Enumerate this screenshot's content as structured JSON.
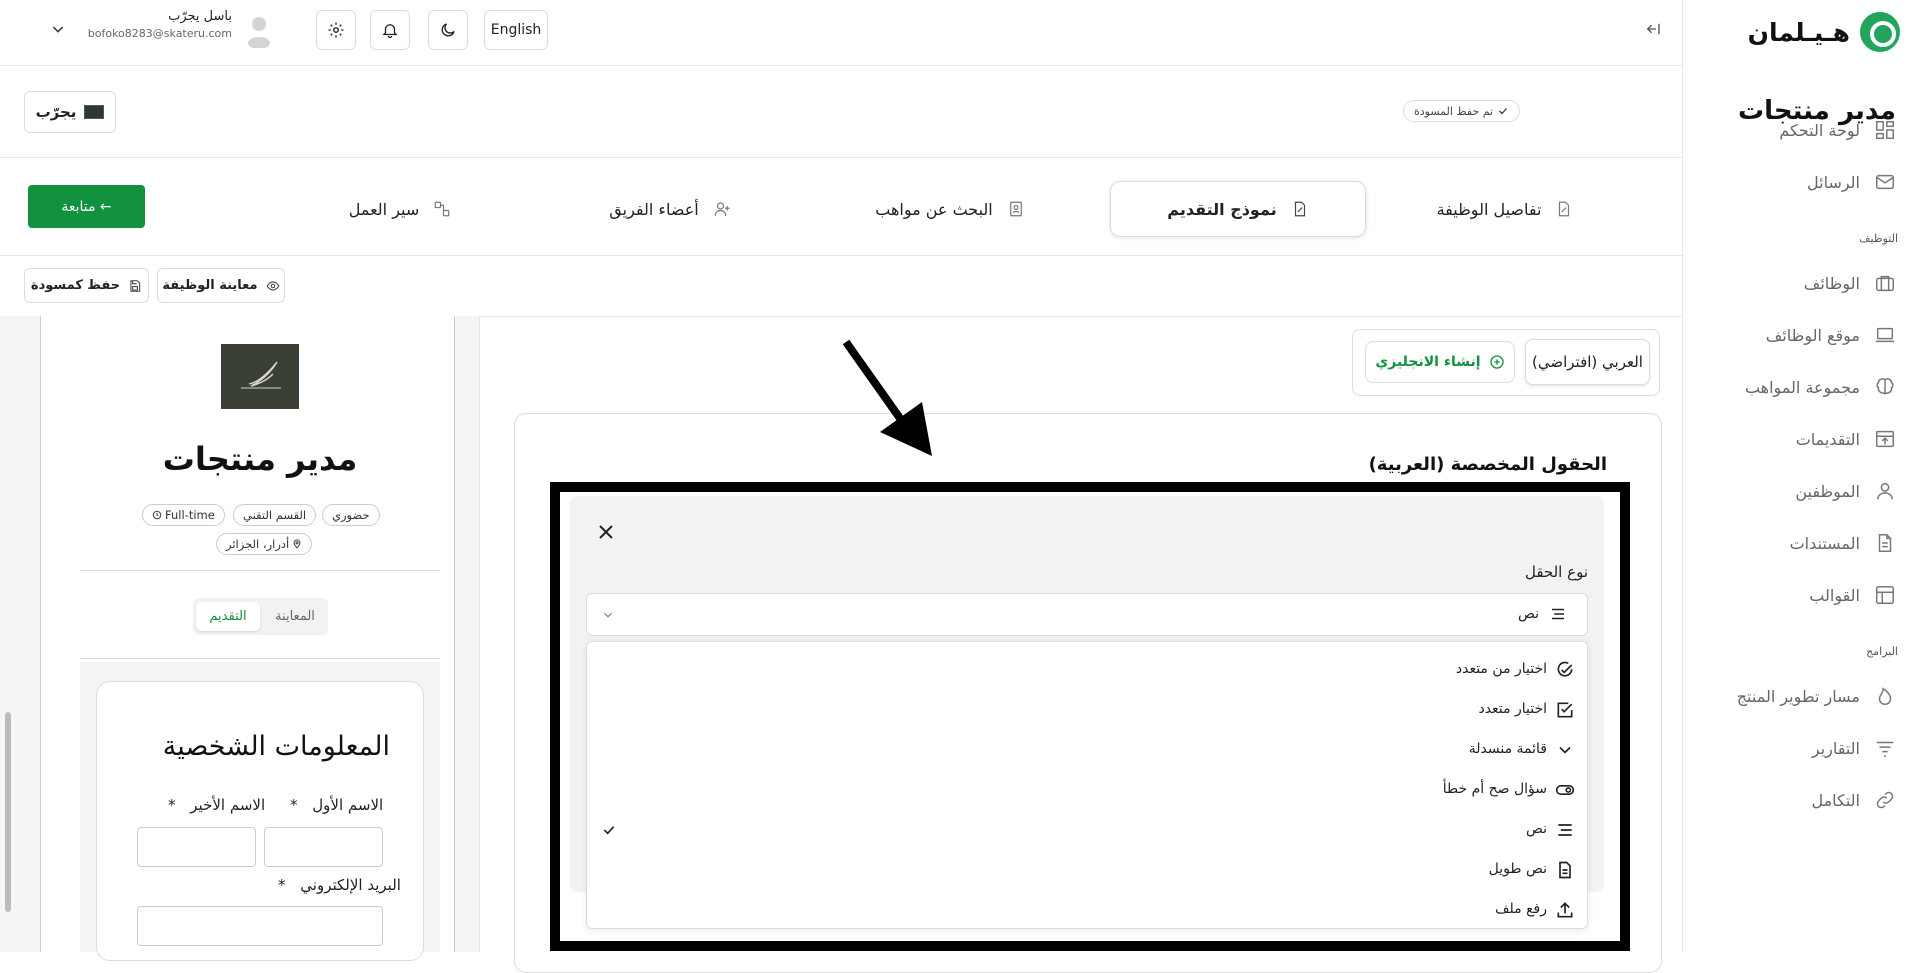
{
  "brand": {
    "name": "هـيـلمان",
    "accent": "#22a45d",
    "primary_green": "#12913f"
  },
  "sidebar": {
    "top_items": [
      {
        "label": "لوحة التحكم",
        "icon": "dashboard-icon"
      },
      {
        "label": "الرسائل",
        "icon": "mail-icon"
      }
    ],
    "section_recruitment": "التوظيف",
    "recruitment_items": [
      {
        "label": "الوظائف",
        "icon": "briefcase-icon"
      },
      {
        "label": "موقع الوظائف",
        "icon": "laptop-icon"
      },
      {
        "label": "مجموعة المواهب",
        "icon": "brain-icon"
      },
      {
        "label": "التقديمات",
        "icon": "inbox-upload-icon"
      },
      {
        "label": "الموظفين",
        "icon": "user-icon"
      },
      {
        "label": "المستندات",
        "icon": "document-icon"
      },
      {
        "label": "القوالب",
        "icon": "template-icon"
      }
    ],
    "section_programs": "البرامج",
    "program_items": [
      {
        "label": "مسار تطوير المنتج",
        "icon": "flame-icon"
      },
      {
        "label": "التقارير",
        "icon": "filter-lines-icon"
      },
      {
        "label": "التكامل",
        "icon": "link-icon"
      }
    ]
  },
  "topbar": {
    "user_name": "باسل يجرّب",
    "user_email": "bofoko8283@skateru.com",
    "language_button": "English"
  },
  "header": {
    "title": "مدير منتجات",
    "draft_status": "تم حفظ المسودة",
    "company_button": "يجرّب"
  },
  "steps": [
    {
      "label": "تفاصيل الوظيفة",
      "icon": "edit-doc-icon"
    },
    {
      "label": "نموذج التقديم",
      "icon": "edit-doc-icon"
    },
    {
      "label": "البحث عن مواهب",
      "icon": "id-badge-icon"
    },
    {
      "label": "أعضاء الفريق",
      "icon": "user-plus-icon"
    },
    {
      "label": "سير العمل",
      "icon": "workflow-icon"
    }
  ],
  "continue_button": "متابعة ←",
  "actions": {
    "preview_job": "معاينة الوظيفة",
    "save_draft": "حفظ كمسودة"
  },
  "preview": {
    "job_title": "مدير منتجات",
    "tags": [
      "حضوري",
      "القسم التقني",
      "Full-time",
      "أدرار، الجزائر"
    ],
    "tabs": [
      "المعاينة",
      "التقديم"
    ],
    "active_tab": "التقديم",
    "section_title": "المعلومات الشخصية",
    "first_name_label": "الاسم الأول",
    "last_name_label": "الاسم الأخير",
    "email_label": "البريد الإلكتروني",
    "required_marker": "*"
  },
  "form_editor": {
    "language_default": "العربي (افتراضي)",
    "create_english": "إنشاء الانجليزي",
    "custom_fields_title": "الحقول المخصصة (العربية)"
  },
  "field_modal": {
    "field_type_label": "نوع الحقل",
    "selected_value": "نص",
    "options": [
      {
        "label": "اختيار من متعدد",
        "icon": "circle-check-icon",
        "selected": false
      },
      {
        "label": "اختيار متعدد",
        "icon": "square-check-icon",
        "selected": false
      },
      {
        "label": "قائمة منسدلة",
        "icon": "chevron-down-icon",
        "selected": false
      },
      {
        "label": "سؤال صح أم خطأ",
        "icon": "toggle-icon",
        "selected": false
      },
      {
        "label": "نص",
        "icon": "text-lines-icon",
        "selected": true
      },
      {
        "label": "نص طويل",
        "icon": "file-text-icon",
        "selected": false
      },
      {
        "label": "رفع ملف",
        "icon": "upload-icon",
        "selected": false
      }
    ]
  }
}
